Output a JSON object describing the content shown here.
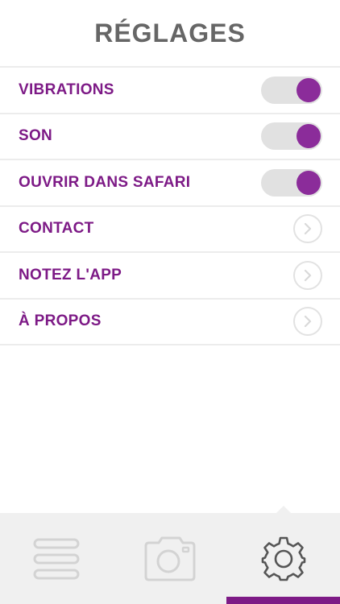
{
  "header": {
    "title": "RÉGLAGES"
  },
  "settings": [
    {
      "label": "VIBRATIONS",
      "control": "toggle",
      "on": true
    },
    {
      "label": "SON",
      "control": "toggle",
      "on": true
    },
    {
      "label": "OUVRIR DANS SAFARI",
      "control": "toggle",
      "on": true
    },
    {
      "label": "CONTACT",
      "control": "chevron"
    },
    {
      "label": "NOTEZ L'APP",
      "control": "chevron"
    },
    {
      "label": "À PROPOS",
      "control": "chevron"
    }
  ],
  "tabbar": {
    "tabs": [
      {
        "name": "list",
        "icon": "list-icon",
        "active": false
      },
      {
        "name": "camera",
        "icon": "camera-icon",
        "active": false
      },
      {
        "name": "settings",
        "icon": "gear-icon",
        "active": true
      }
    ]
  },
  "colors": {
    "accent": "#7d1a86",
    "toggle_knob": "#8b2c9a",
    "toggle_track": "#e1e1e1",
    "title": "#666666",
    "tabbar_bg": "#f0f0f0"
  }
}
